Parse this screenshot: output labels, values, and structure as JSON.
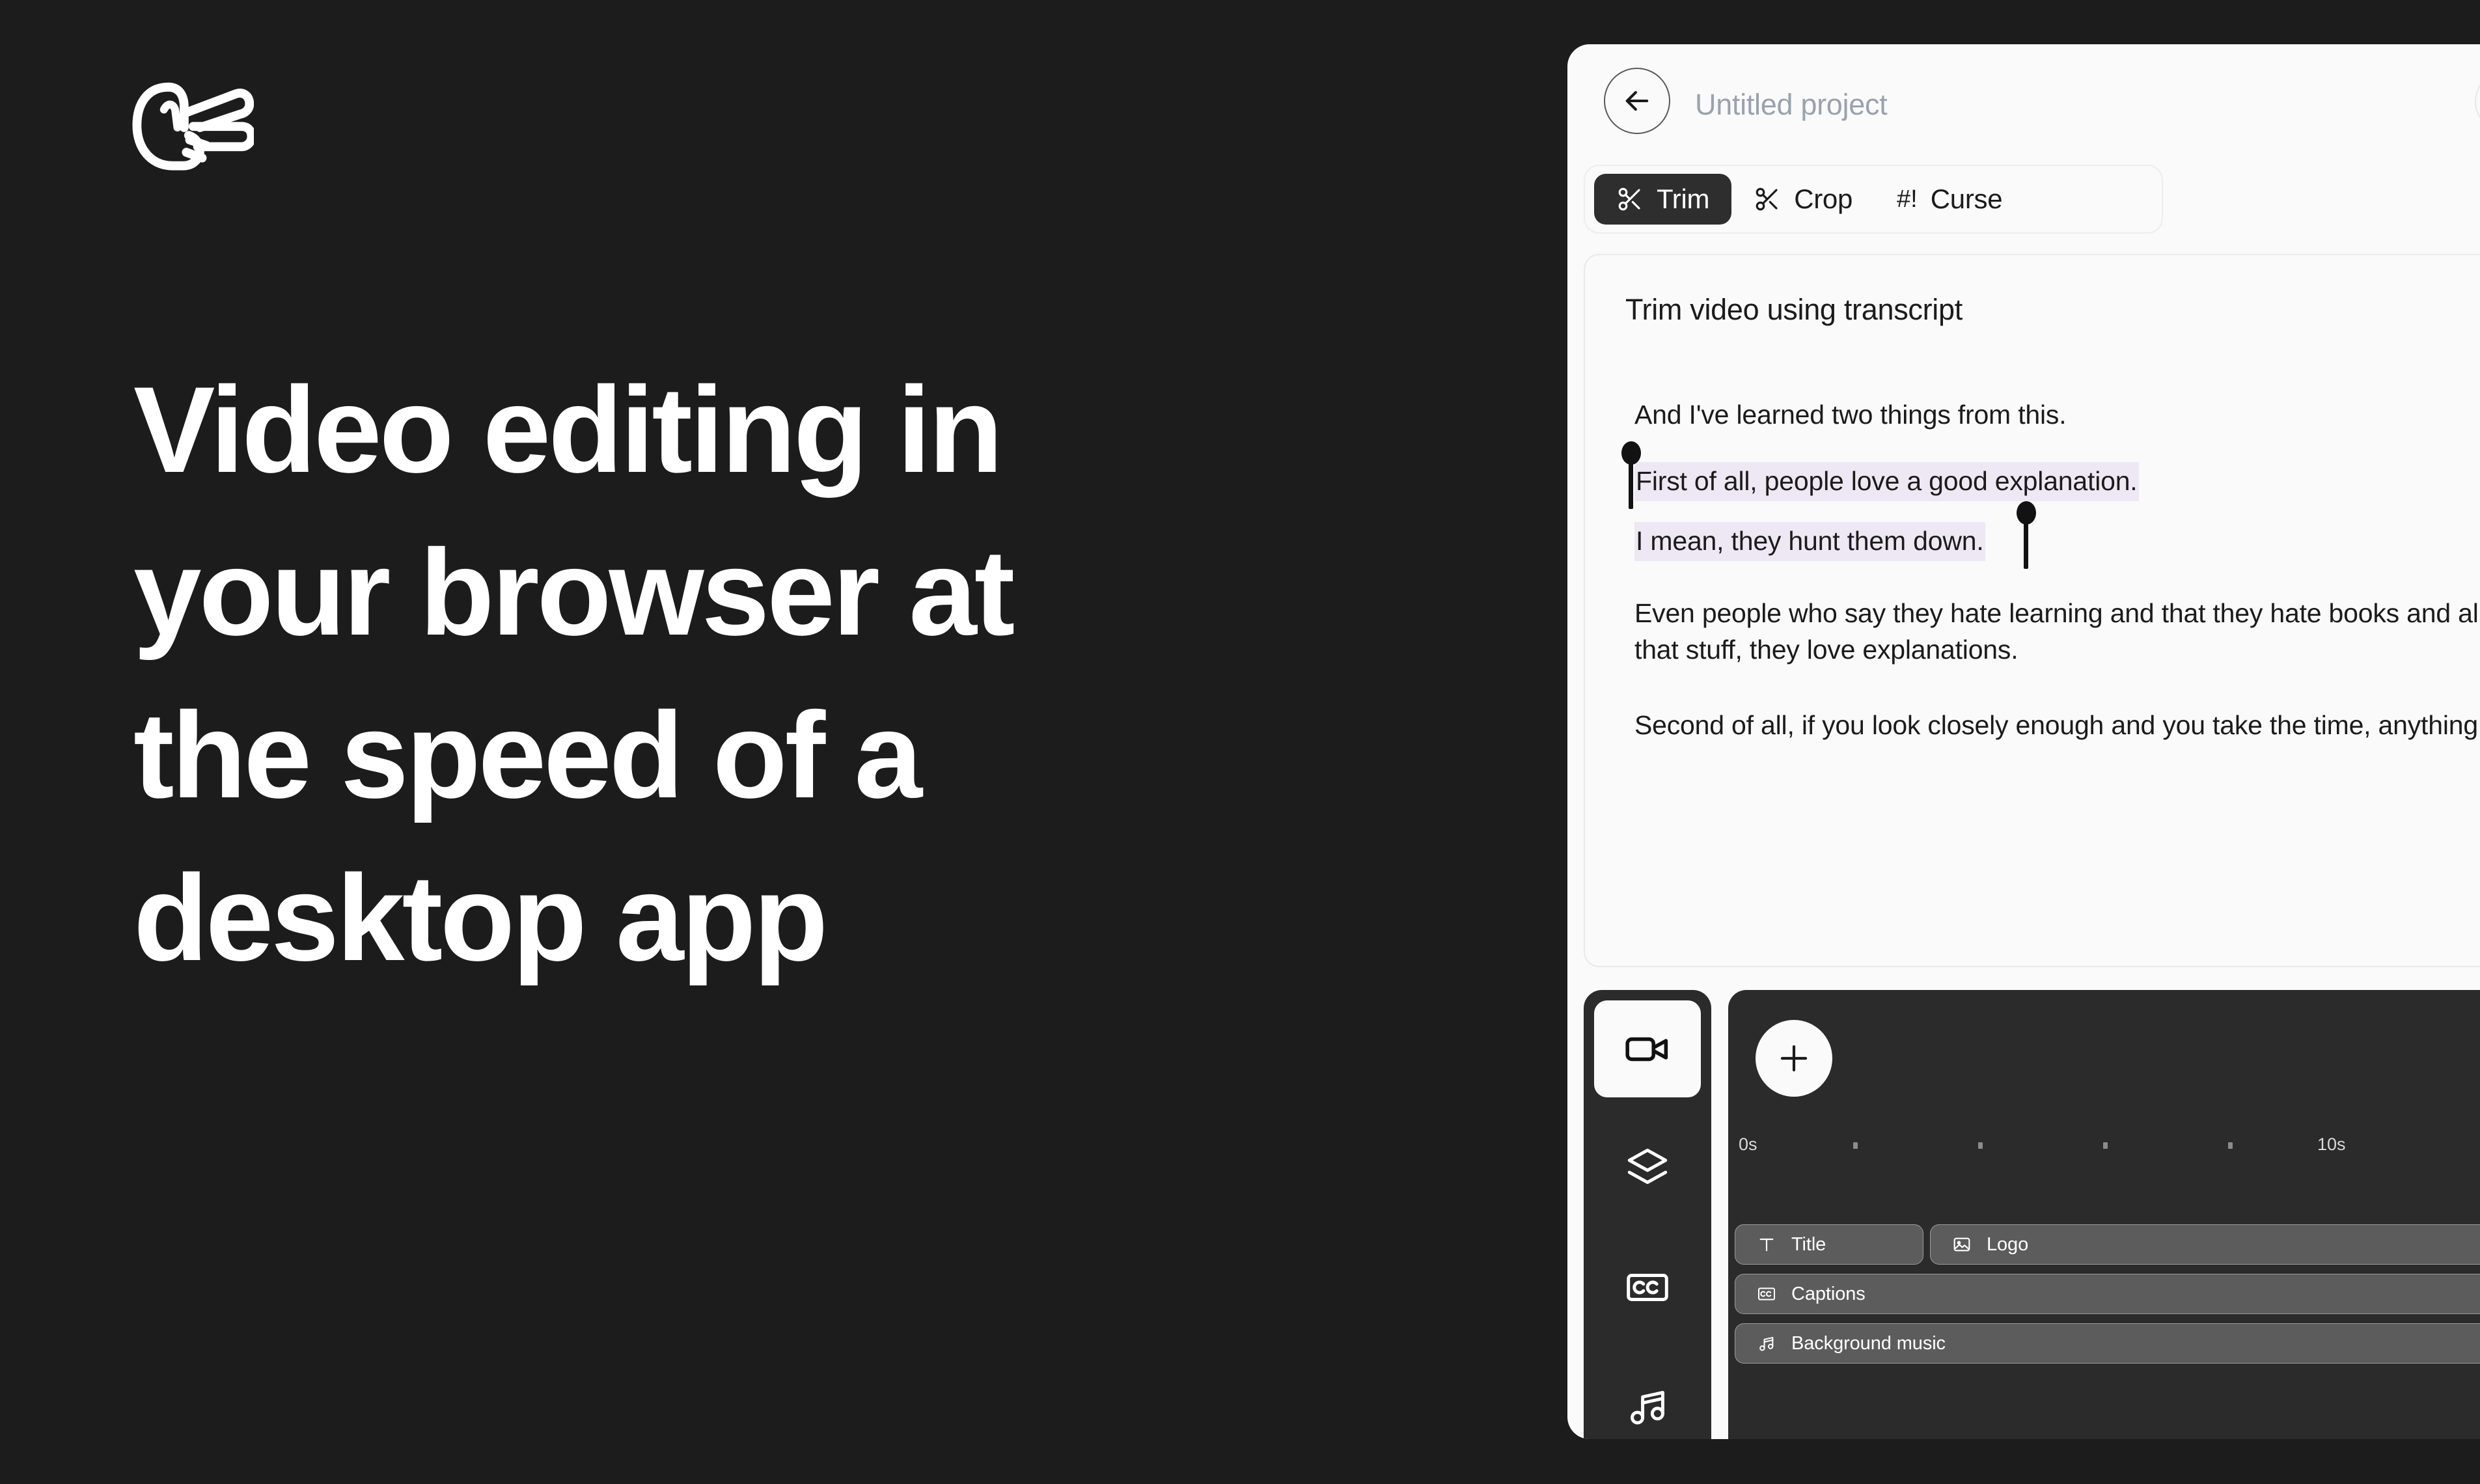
{
  "brand": {
    "logo_icon": "hand-scissors-icon"
  },
  "hero": {
    "headline_lines": [
      "Video editing in",
      "your browser at",
      "the speed of a",
      "desktop app"
    ]
  },
  "app": {
    "header": {
      "back_icon": "arrow-left-icon",
      "project_title": "Untitled project"
    },
    "tabs": [
      {
        "label": "Trim",
        "icon": "scissors-icon",
        "active": true
      },
      {
        "label": "Crop",
        "icon": "scissors-icon",
        "active": false
      },
      {
        "label": "Curse",
        "icon": "hashbang-icon",
        "glyph": "#!",
        "active": false
      }
    ],
    "transcript": {
      "title": "Trim video using transcript",
      "lines": [
        {
          "text": "And I've learned two things from this.",
          "highlighted": false
        },
        {
          "text": "First of all, people love a good explanation.",
          "highlighted": true
        },
        {
          "text": "I mean, they hunt them down.",
          "highlighted": true
        }
      ],
      "paragraphs": [
        "Even people who say they hate learning and that they hate books and all that stuff, they love explanations.",
        "Second of all, if you look closely enough and you take the time, anything."
      ],
      "selection_highlight_color": "#eee8f5"
    },
    "tool_rail": [
      {
        "name": "video-camera-icon",
        "active": true
      },
      {
        "name": "layers-icon",
        "active": false
      },
      {
        "name": "closed-captions-icon",
        "active": false
      },
      {
        "name": "music-note-icon",
        "active": false
      }
    ],
    "timeline": {
      "add_icon": "plus-icon",
      "collapse_icon": "chevron-left-icon",
      "ruler": {
        "start_label": "0s",
        "end_label": "10s",
        "tick_count": 4
      },
      "clips": [
        {
          "label": "Title",
          "icon": "text-icon",
          "track": 0
        },
        {
          "label": "Logo",
          "icon": "image-icon",
          "track": 0
        },
        {
          "label": "Captions",
          "icon": "closed-captions-icon",
          "track": 1
        },
        {
          "label": "Background music",
          "icon": "music-note-icon",
          "track": 2
        }
      ]
    }
  },
  "colors": {
    "page_background": "#1c1c1c",
    "app_background": "#fafafa",
    "accent_dark": "#2e2e2e",
    "clip_fill": "#5c5c5c",
    "muted_text": "#9aa2ad"
  }
}
